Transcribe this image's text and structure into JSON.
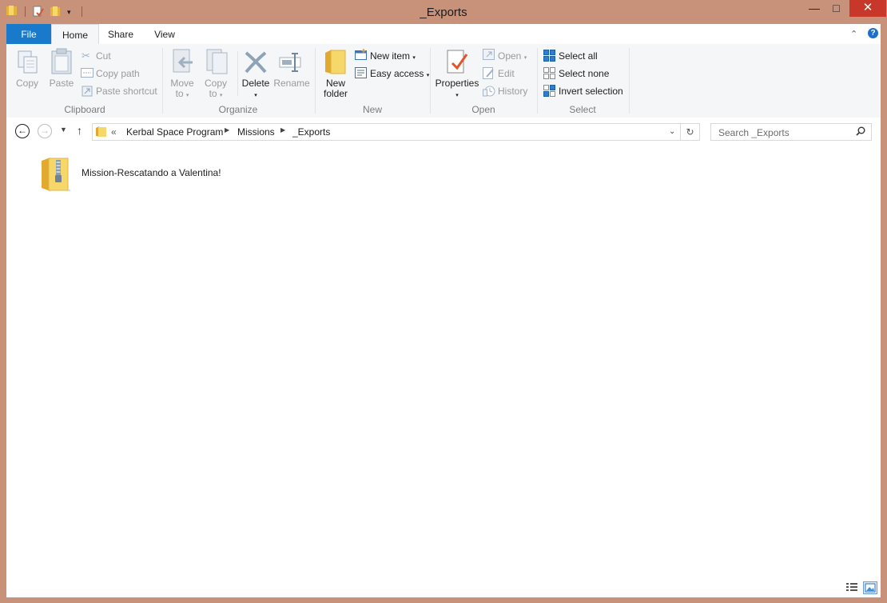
{
  "window": {
    "title": "_Exports",
    "min_symbol": "—",
    "max_symbol": "□",
    "close_symbol": "✕"
  },
  "tabs": {
    "file": "File",
    "home": "Home",
    "share": "Share",
    "view": "View"
  },
  "ribbon": {
    "clipboard": {
      "label": "Clipboard",
      "copy": "Copy",
      "paste": "Paste",
      "cut": "Cut",
      "copy_path": "Copy path",
      "paste_shortcut": "Paste shortcut"
    },
    "organize": {
      "label": "Organize",
      "move_to_1": "Move",
      "move_to_2": "to",
      "copy_to_1": "Copy",
      "copy_to_2": "to",
      "delete": "Delete",
      "rename": "Rename"
    },
    "new": {
      "label": "New",
      "new_folder_1": "New",
      "new_folder_2": "folder",
      "new_item": "New item",
      "easy_access": "Easy access"
    },
    "open": {
      "label": "Open",
      "properties": "Properties",
      "open": "Open",
      "edit": "Edit",
      "history": "History"
    },
    "select": {
      "label": "Select",
      "select_all": "Select all",
      "select_none": "Select none",
      "invert_selection": "Invert selection"
    }
  },
  "nav": {
    "overflow": "«",
    "crumbs": [
      "Kerbal Space Program",
      "Missions",
      "_Exports"
    ],
    "search_placeholder": "Search _Exports"
  },
  "files": [
    {
      "name": "Mission-Rescatando a Valentina!",
      "icon": "zip-folder-icon"
    }
  ],
  "colors": {
    "frame": "#c7917a",
    "file_tab": "#1979ca",
    "close_button": "#c7382b",
    "ribbon_bg": "#f5f6f7",
    "folder_yellow": "#f3c94a"
  }
}
